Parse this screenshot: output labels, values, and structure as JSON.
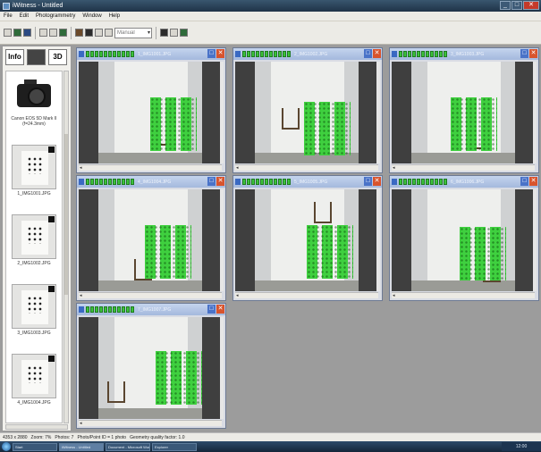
{
  "window": {
    "title": "iWitness - Untitled",
    "controls": [
      "_",
      "□",
      "✕"
    ]
  },
  "menu": [
    "File",
    "Edit",
    "Photogrammetry",
    "Window",
    "Help"
  ],
  "toolbar": {
    "combo_placeholder": "Manual"
  },
  "view_tabs": [
    "Info",
    "",
    "3D"
  ],
  "thumbnails": [
    {
      "kind": "camera",
      "label": "Canon EOS 5D Mark II (f=24.3mm)"
    },
    {
      "kind": "photo",
      "label": "1_IMG1001.JPG"
    },
    {
      "kind": "photo",
      "label": "2_IMG1002.JPG"
    },
    {
      "kind": "photo",
      "label": "3_IMG1003.JPG"
    },
    {
      "kind": "photo",
      "label": "4_IMG1004.JPG"
    }
  ],
  "photo_windows": [
    {
      "name": "1_IMG1001.JPG"
    },
    {
      "name": "2_IMG1002.JPG"
    },
    {
      "name": "3_IMG1003.JPG"
    },
    {
      "name": "4_IMG1004.JPG"
    },
    {
      "name": "5_IMG1005.JPG"
    },
    {
      "name": "6_IMG1006.JPG"
    },
    {
      "name": "7_IMG1007.JPG"
    }
  ],
  "quality_bars": 11,
  "statusbar": {
    "coords": "4353 x 2880",
    "zoom": "Zoom: 7%",
    "photos": "Photos: 7",
    "info": "Photo/Point ID = 1 photo",
    "geometry": "Geometry quality factor: 1.0"
  },
  "taskbar": {
    "tasks": [
      "Start",
      "iWitness - Untitled",
      "Document - Microsoft Word",
      "Explorer"
    ],
    "tray_time": "12:00"
  }
}
